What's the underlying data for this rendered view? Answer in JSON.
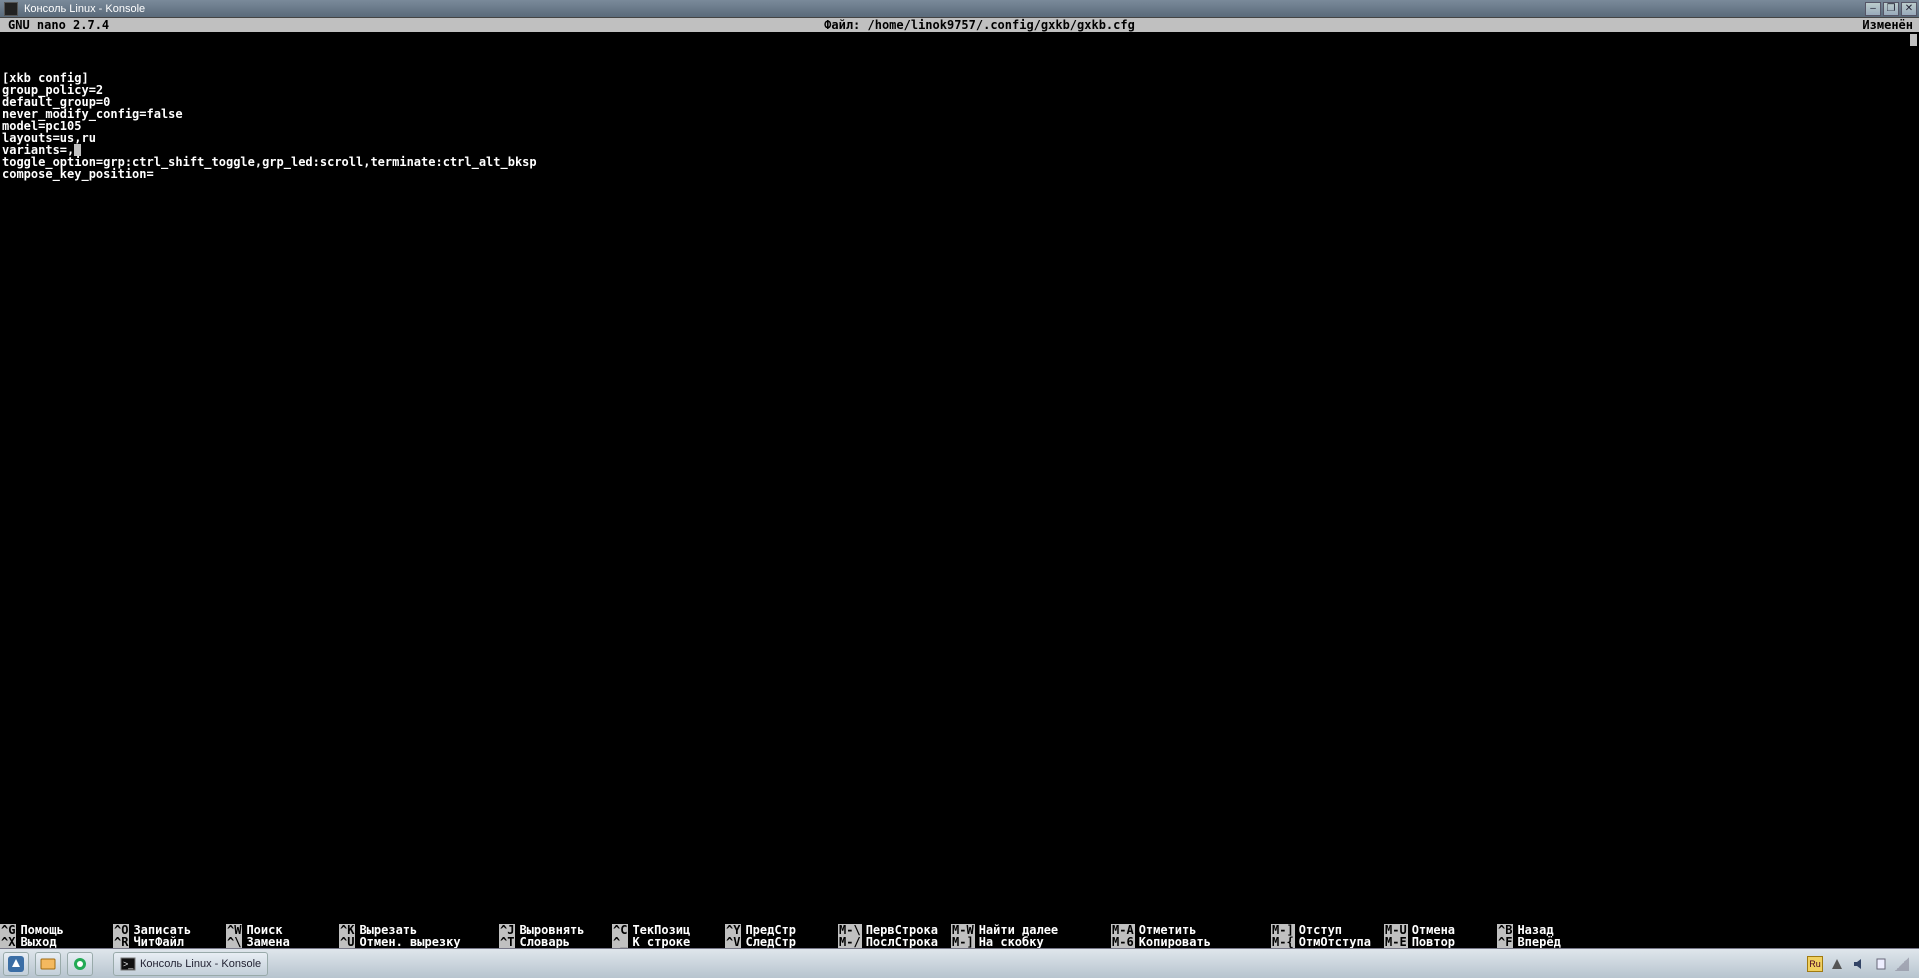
{
  "window": {
    "title": "Консоль Linux - Konsole"
  },
  "nano": {
    "app": "GNU nano 2.7.4",
    "file_label": "Файл: /home/linok9757/.config/gxkb/gxkb.cfg",
    "status": "Изменён"
  },
  "content": {
    "lines": [
      "[xkb config]",
      "group_policy=2",
      "default_group=0",
      "never_modify_config=false",
      "model=pc105",
      "layouts=us,ru",
      "variants=,",
      "toggle_option=grp:ctrl_shift_toggle,grp_led:scroll,terminate:ctrl_alt_bksp",
      "compose_key_position="
    ],
    "cursor_line_index": 6
  },
  "help": {
    "row1": [
      {
        "k": "^G",
        "l": "Помощь"
      },
      {
        "k": "^O",
        "l": "Записать"
      },
      {
        "k": "^W",
        "l": "Поиск"
      },
      {
        "k": "^K",
        "l": "Вырезать"
      },
      {
        "k": "^J",
        "l": "Выровнять"
      },
      {
        "k": "^C",
        "l": "ТекПозиц"
      },
      {
        "k": "^Y",
        "l": "ПредСтр"
      },
      {
        "k": "M-\\",
        "l": "ПервСтрока"
      },
      {
        "k": "M-W",
        "l": "Найти далее"
      },
      {
        "k": "M-A",
        "l": "Отметить"
      },
      {
        "k": "M-]",
        "l": "Отступ"
      },
      {
        "k": "M-U",
        "l": "Отмена"
      },
      {
        "k": "^B",
        "l": "Назад"
      }
    ],
    "row2": [
      {
        "k": "^X",
        "l": "Выход"
      },
      {
        "k": "^R",
        "l": "ЧитФайл"
      },
      {
        "k": "^\\",
        "l": "Замена"
      },
      {
        "k": "^U",
        "l": "Отмен. вырезку"
      },
      {
        "k": "^T",
        "l": "Словарь"
      },
      {
        "k": "^_",
        "l": "К строке"
      },
      {
        "k": "^V",
        "l": "СледСтр"
      },
      {
        "k": "M-/",
        "l": "ПослСтрока"
      },
      {
        "k": "M-]",
        "l": "На скобку"
      },
      {
        "k": "M-6",
        "l": "Копировать"
      },
      {
        "k": "M-{",
        "l": "ОтмОтступа"
      },
      {
        "k": "M-E",
        "l": "Повтор"
      },
      {
        "k": "^F",
        "l": "Вперёд"
      }
    ]
  },
  "taskbar": {
    "active_task": "Консоль Linux - Konsole"
  }
}
